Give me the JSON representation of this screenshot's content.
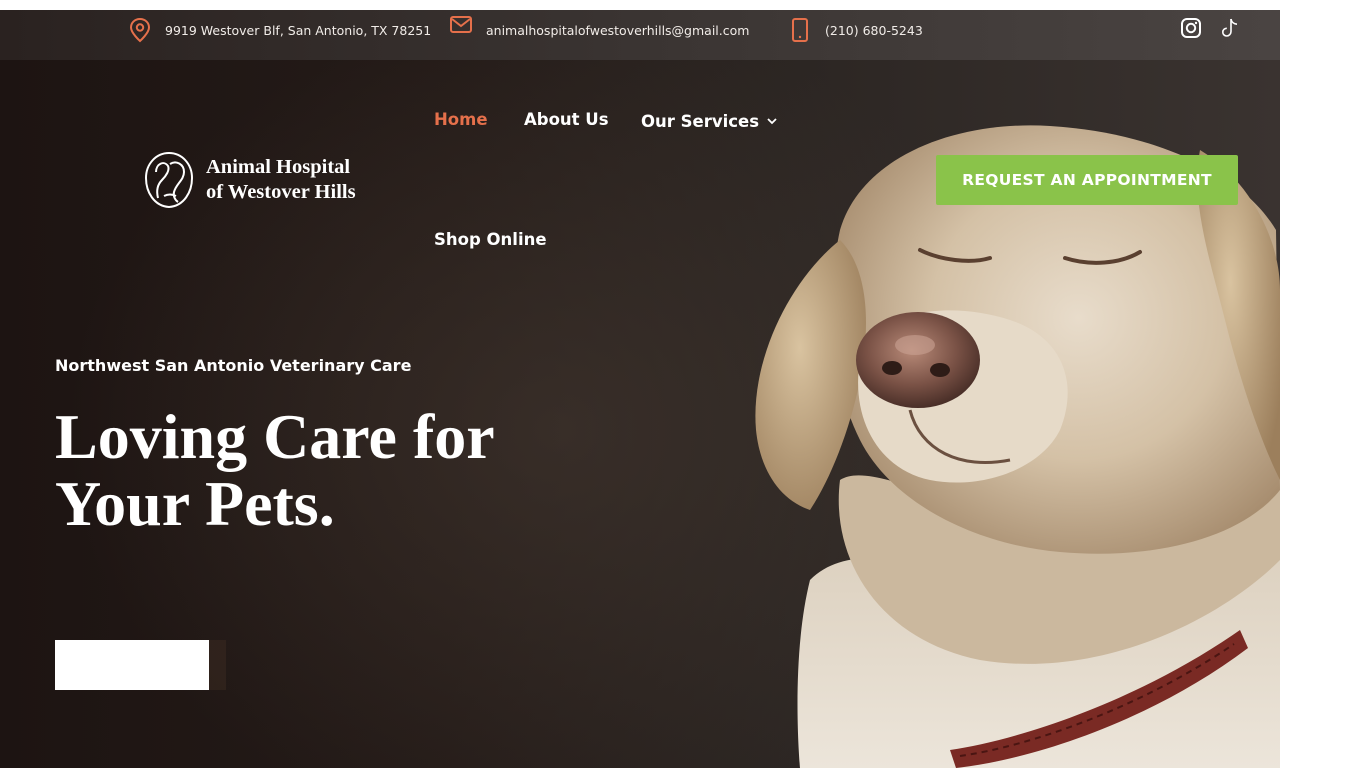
{
  "info_bar": {
    "address": "9919 Westover Blf, San Antonio, TX 78251",
    "email": "animalhospitalofwestoverhills@gmail.com",
    "phone": "(210) 680-5243",
    "icons": [
      "map-pin-icon",
      "mail-icon",
      "phone-icon",
      "instagram-icon",
      "tiktok-icon"
    ]
  },
  "logo": {
    "line1": "Animal Hospital",
    "line2": "of Westover Hills"
  },
  "nav": {
    "home": "Home",
    "about": "About Us",
    "services": "Our Services",
    "shop": "Shop Online"
  },
  "cta": {
    "label": "REQUEST AN APPOINTMENT"
  },
  "hero": {
    "eyebrow": "Northwest San Antonio Veterinary Care",
    "headline_line1": "Loving Care for",
    "headline_line2": "Your Pets."
  },
  "colors": {
    "accent": "#e5704b",
    "cta_green": "#8ac34a",
    "hero_dark": "#241b18"
  }
}
